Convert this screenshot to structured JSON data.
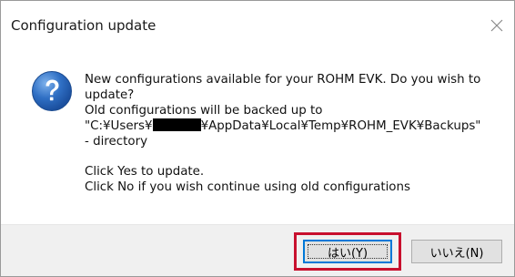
{
  "dialog": {
    "title": "Configuration update",
    "close_icon": "close-icon",
    "question_icon": "question-icon",
    "message": {
      "line1": "New configurations available for your ROHM EVK. Do you wish to",
      "line2": "update?",
      "line3": "Old configurations will be backed up to",
      "line4_prefix": "\"C:¥Users¥",
      "line4_suffix": "¥AppData¥Local¥Temp¥ROHM_EVK¥Backups\"",
      "line5": "- directory",
      "line6": "Click Yes to update.",
      "line7": "Click No if you wish continue using old configurations"
    }
  },
  "buttons": {
    "yes_label": "はい(Y)",
    "no_label": "いいえ(N)"
  },
  "colors": {
    "highlight": "#c8102e",
    "focus_border": "#0078d7",
    "footer_bg": "#f0f0f0",
    "icon_blue": "#2f6fc4"
  }
}
